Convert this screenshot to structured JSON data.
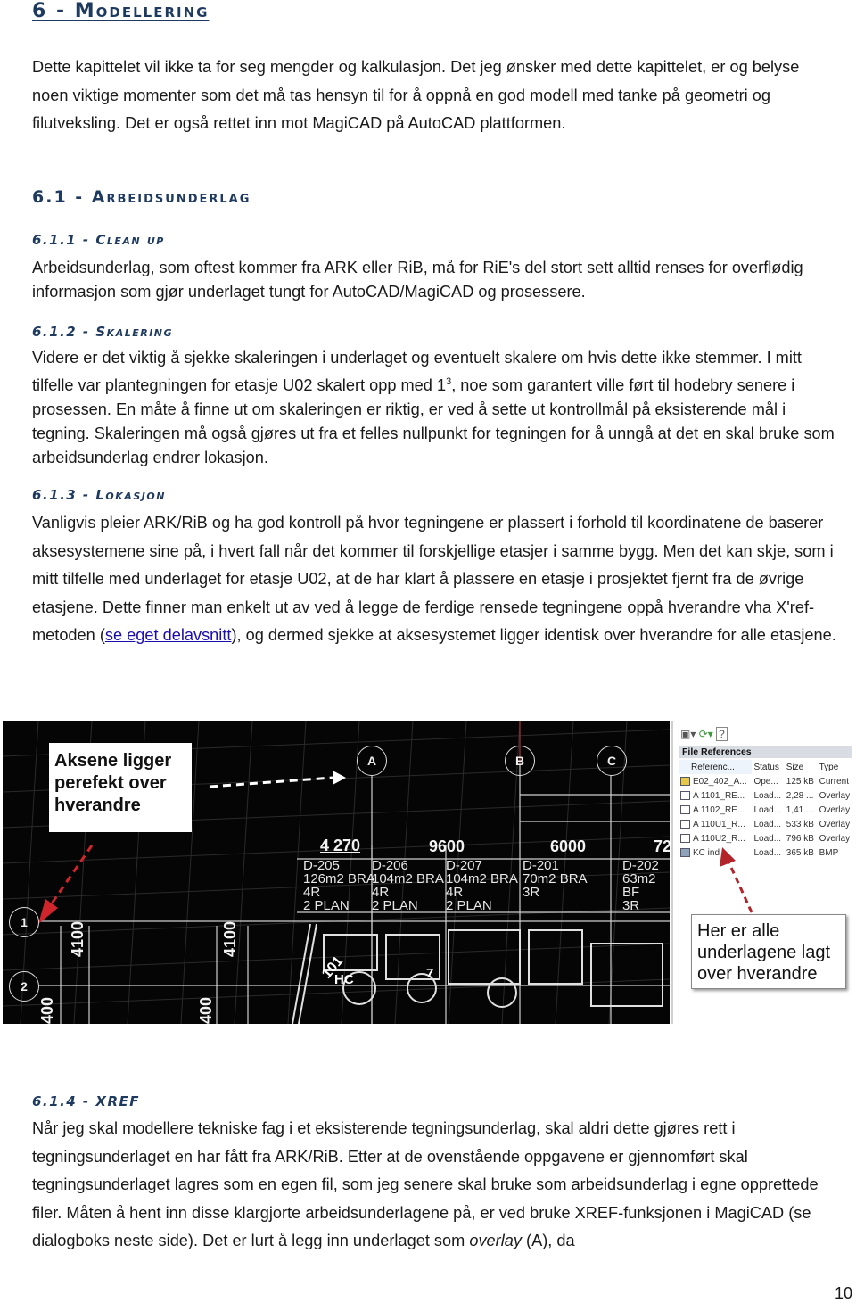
{
  "heading": "6 - Modellering",
  "intro": "Dette kapittelet vil ikke ta for seg mengder og kalkulasjon. Det jeg ønsker med dette kapittelet, er og belyse noen viktige momenter som det må tas hensyn til for å oppnå en god modell med tanke på geometri og filutveksling. Det er også rettet inn mot MagiCAD på AutoCAD plattformen.",
  "section": {
    "title": "6.1 - Arbeidsunderlag",
    "subsections": [
      {
        "title": "6.1.1 - Clean up",
        "text": "Arbeidsunderlag, som oftest kommer fra ARK eller RiB, må for RiE's del stort sett alltid renses for overflødig informasjon som gjør underlaget tungt for AutoCAD/MagiCAD og prosessere."
      },
      {
        "title": "6.1.2 - Skalering",
        "text_before_sup": "Videre er det viktig å sjekke skaleringen i underlaget og eventuelt skalere om hvis dette ikke stemmer. I mitt tilfelle var plantegningen for etasje U02 skalert opp med 1",
        "sup": "3",
        "text_after_sup": ", noe som garantert ville ført til hodebry senere i prosessen. En måte å finne ut om skaleringen er riktig, er ved å sette ut kontrollmål på eksisterende mål i tegning. Skaleringen må også gjøres ut fra et felles nullpunkt for tegningen for å unngå at det en skal bruke som arbeidsunderlag endrer lokasjon."
      },
      {
        "title": "6.1.3 - Lokasjon",
        "text_before_link": "Vanligvis pleier ARK/RiB og ha god kontroll på hvor tegningene er plassert i forhold til koordinatene de baserer aksesystemene sine på, i hvert fall når det kommer til forskjellige etasjer i samme bygg. Men det kan skje, som i mitt tilfelle med underlaget for etasje U02, at de har klart å plassere en etasje i prosjektet fjernt fra de øvrige etasjene. Dette finner man enkelt ut av ved å legge de ferdige rensede tegningene oppå hverandre vha X'ref-metoden (",
        "link": "se eget delavsnitt",
        "text_after_link": "), og dermed sjekke at aksesystemet ligger identisk over hverandre for alle etasjene."
      },
      {
        "title": "6.1.4 - XREF",
        "text_before_italic": "Når jeg skal modellere tekniske fag i et eksisterende tegningsunderlag, skal aldri dette gjøres rett i tegningsunderlaget en har fått fra ARK/RiB. Etter at de ovenstående oppgavene er gjennomført skal tegningsunderlaget lagres som en egen fil, som jeg senere skal bruke som arbeidsunderlag i egne opprettede filer. Måten å hent inn disse klargjorte arbeidsunderlagene på, er ved bruke XREF-funksjonen i MagiCAD (se dialogboks neste side). Det er lurt å legg inn underlaget som ",
        "italic": "overlay",
        "text_after_italic": " (A), da"
      }
    ]
  },
  "figure": {
    "callout_left": "Aksene ligger perefekt over hverandre",
    "callout_right": "Her er alle underlagene lagt over hverandre",
    "axis_labels": [
      "A",
      "B",
      "C",
      "1",
      "2"
    ],
    "dimensions_horizontal": [
      "4 270",
      "9600",
      "6000",
      "72"
    ],
    "dimensions_vertical": [
      "4100",
      "4100",
      "400",
      "400"
    ],
    "rooms": [
      {
        "id": "D-205",
        "area": "126m2 BRA",
        "rooms": "4R",
        "plan": "2 PLAN"
      },
      {
        "id": "D-206",
        "area": "104m2 BRA",
        "rooms": "4R",
        "plan": "2 PLAN"
      },
      {
        "id": "D-207",
        "area": "104m2 BRA",
        "rooms": "4R",
        "plan": "2 PLAN"
      },
      {
        "id": "D-201",
        "area": "70m2 BRA",
        "rooms": "3R",
        "plan": ""
      },
      {
        "id": "D-202",
        "area": "63m2 BF",
        "rooms": "3R",
        "plan": ""
      }
    ],
    "plan_labels": [
      "101",
      "HC",
      "7"
    ],
    "file_references": {
      "title": "File References",
      "columns": [
        "Referenc...",
        "Status",
        "Size",
        "Type"
      ],
      "rows": [
        {
          "icon": "current-drawing-icon",
          "name": "E02_402_A...",
          "status": "Ope...",
          "size": "125 kB",
          "type": "Current"
        },
        {
          "icon": "xref-icon",
          "name": "A 1101_RE...",
          "status": "Load...",
          "size": "2,28 ...",
          "type": "Overlay"
        },
        {
          "icon": "xref-icon",
          "name": "A 1102_RE...",
          "status": "Load...",
          "size": "1,41 ...",
          "type": "Overlay"
        },
        {
          "icon": "xref-icon",
          "name": "A 110U1_R...",
          "status": "Load...",
          "size": "533 kB",
          "type": "Overlay"
        },
        {
          "icon": "xref-icon",
          "name": "A 110U2_R...",
          "status": "Load...",
          "size": "796 kB",
          "type": "Overlay"
        },
        {
          "icon": "image-icon",
          "name": "KC ind",
          "status": "Load...",
          "size": "365 kB",
          "type": "BMP"
        }
      ]
    }
  },
  "page_number": "10",
  "colors": {
    "heading": "#1f3a5f",
    "link": "#1a0dab",
    "arrow_red": "#c0282d",
    "cad_background": "#050505"
  }
}
